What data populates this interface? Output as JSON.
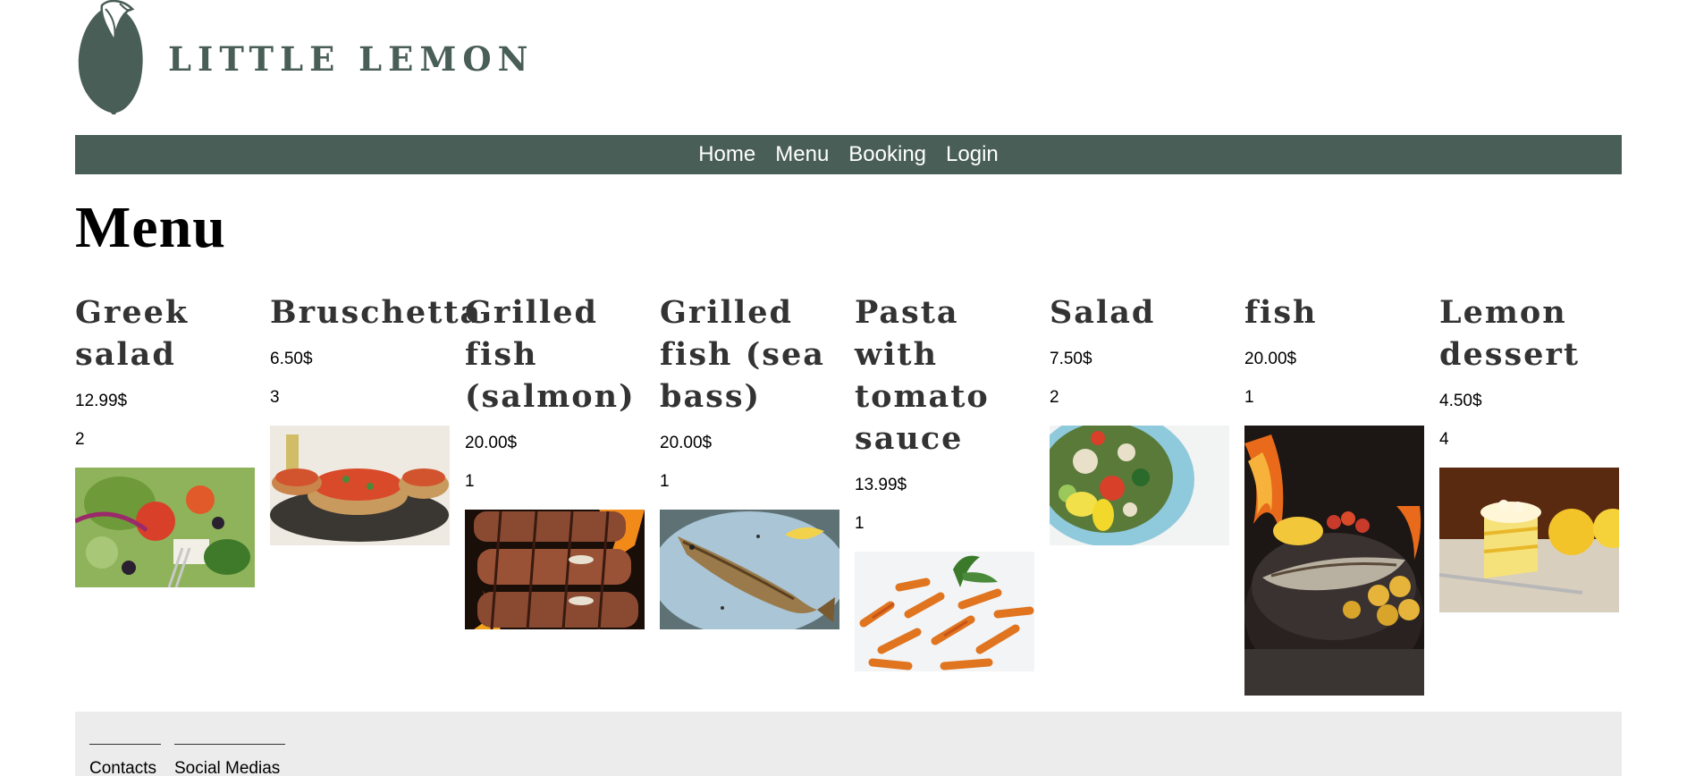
{
  "brand": {
    "name": "LITTLE LEMON",
    "color": "#495e57",
    "logo_icon": "lemon-icon"
  },
  "nav": {
    "items": [
      "Home",
      "Menu",
      "Booking",
      "Login"
    ],
    "background": "#495e57"
  },
  "page": {
    "title": "Menu"
  },
  "menu": {
    "items": [
      {
        "name": "Greek salad",
        "price": "12.99$",
        "quantity": "2",
        "image_icon": "greek-salad-photo"
      },
      {
        "name": "Bruschetta",
        "price": "6.50$",
        "quantity": "3",
        "image_icon": "bruschetta-photo"
      },
      {
        "name": "Grilled fish (salmon)",
        "price": "20.00$",
        "quantity": "1",
        "image_icon": "grilled-salmon-photo"
      },
      {
        "name": "Grilled fish (sea bass)",
        "price": "20.00$",
        "quantity": "1",
        "image_icon": "grilled-sea-bass-photo"
      },
      {
        "name": "Pasta with tomato sauce",
        "price": "13.99$",
        "quantity": "1",
        "image_icon": "pasta-photo"
      },
      {
        "name": "Salad",
        "price": "7.50$",
        "quantity": "2",
        "image_icon": "salad-photo"
      },
      {
        "name": "fish",
        "price": "20.00$",
        "quantity": "1",
        "image_icon": "grill-fish-photo"
      },
      {
        "name": "Lemon dessert",
        "price": "4.50$",
        "quantity": "4",
        "image_icon": "lemon-dessert-photo"
      }
    ]
  },
  "footer": {
    "columns": [
      "Contacts",
      "Social Medias"
    ],
    "background": "#ebeceb"
  }
}
